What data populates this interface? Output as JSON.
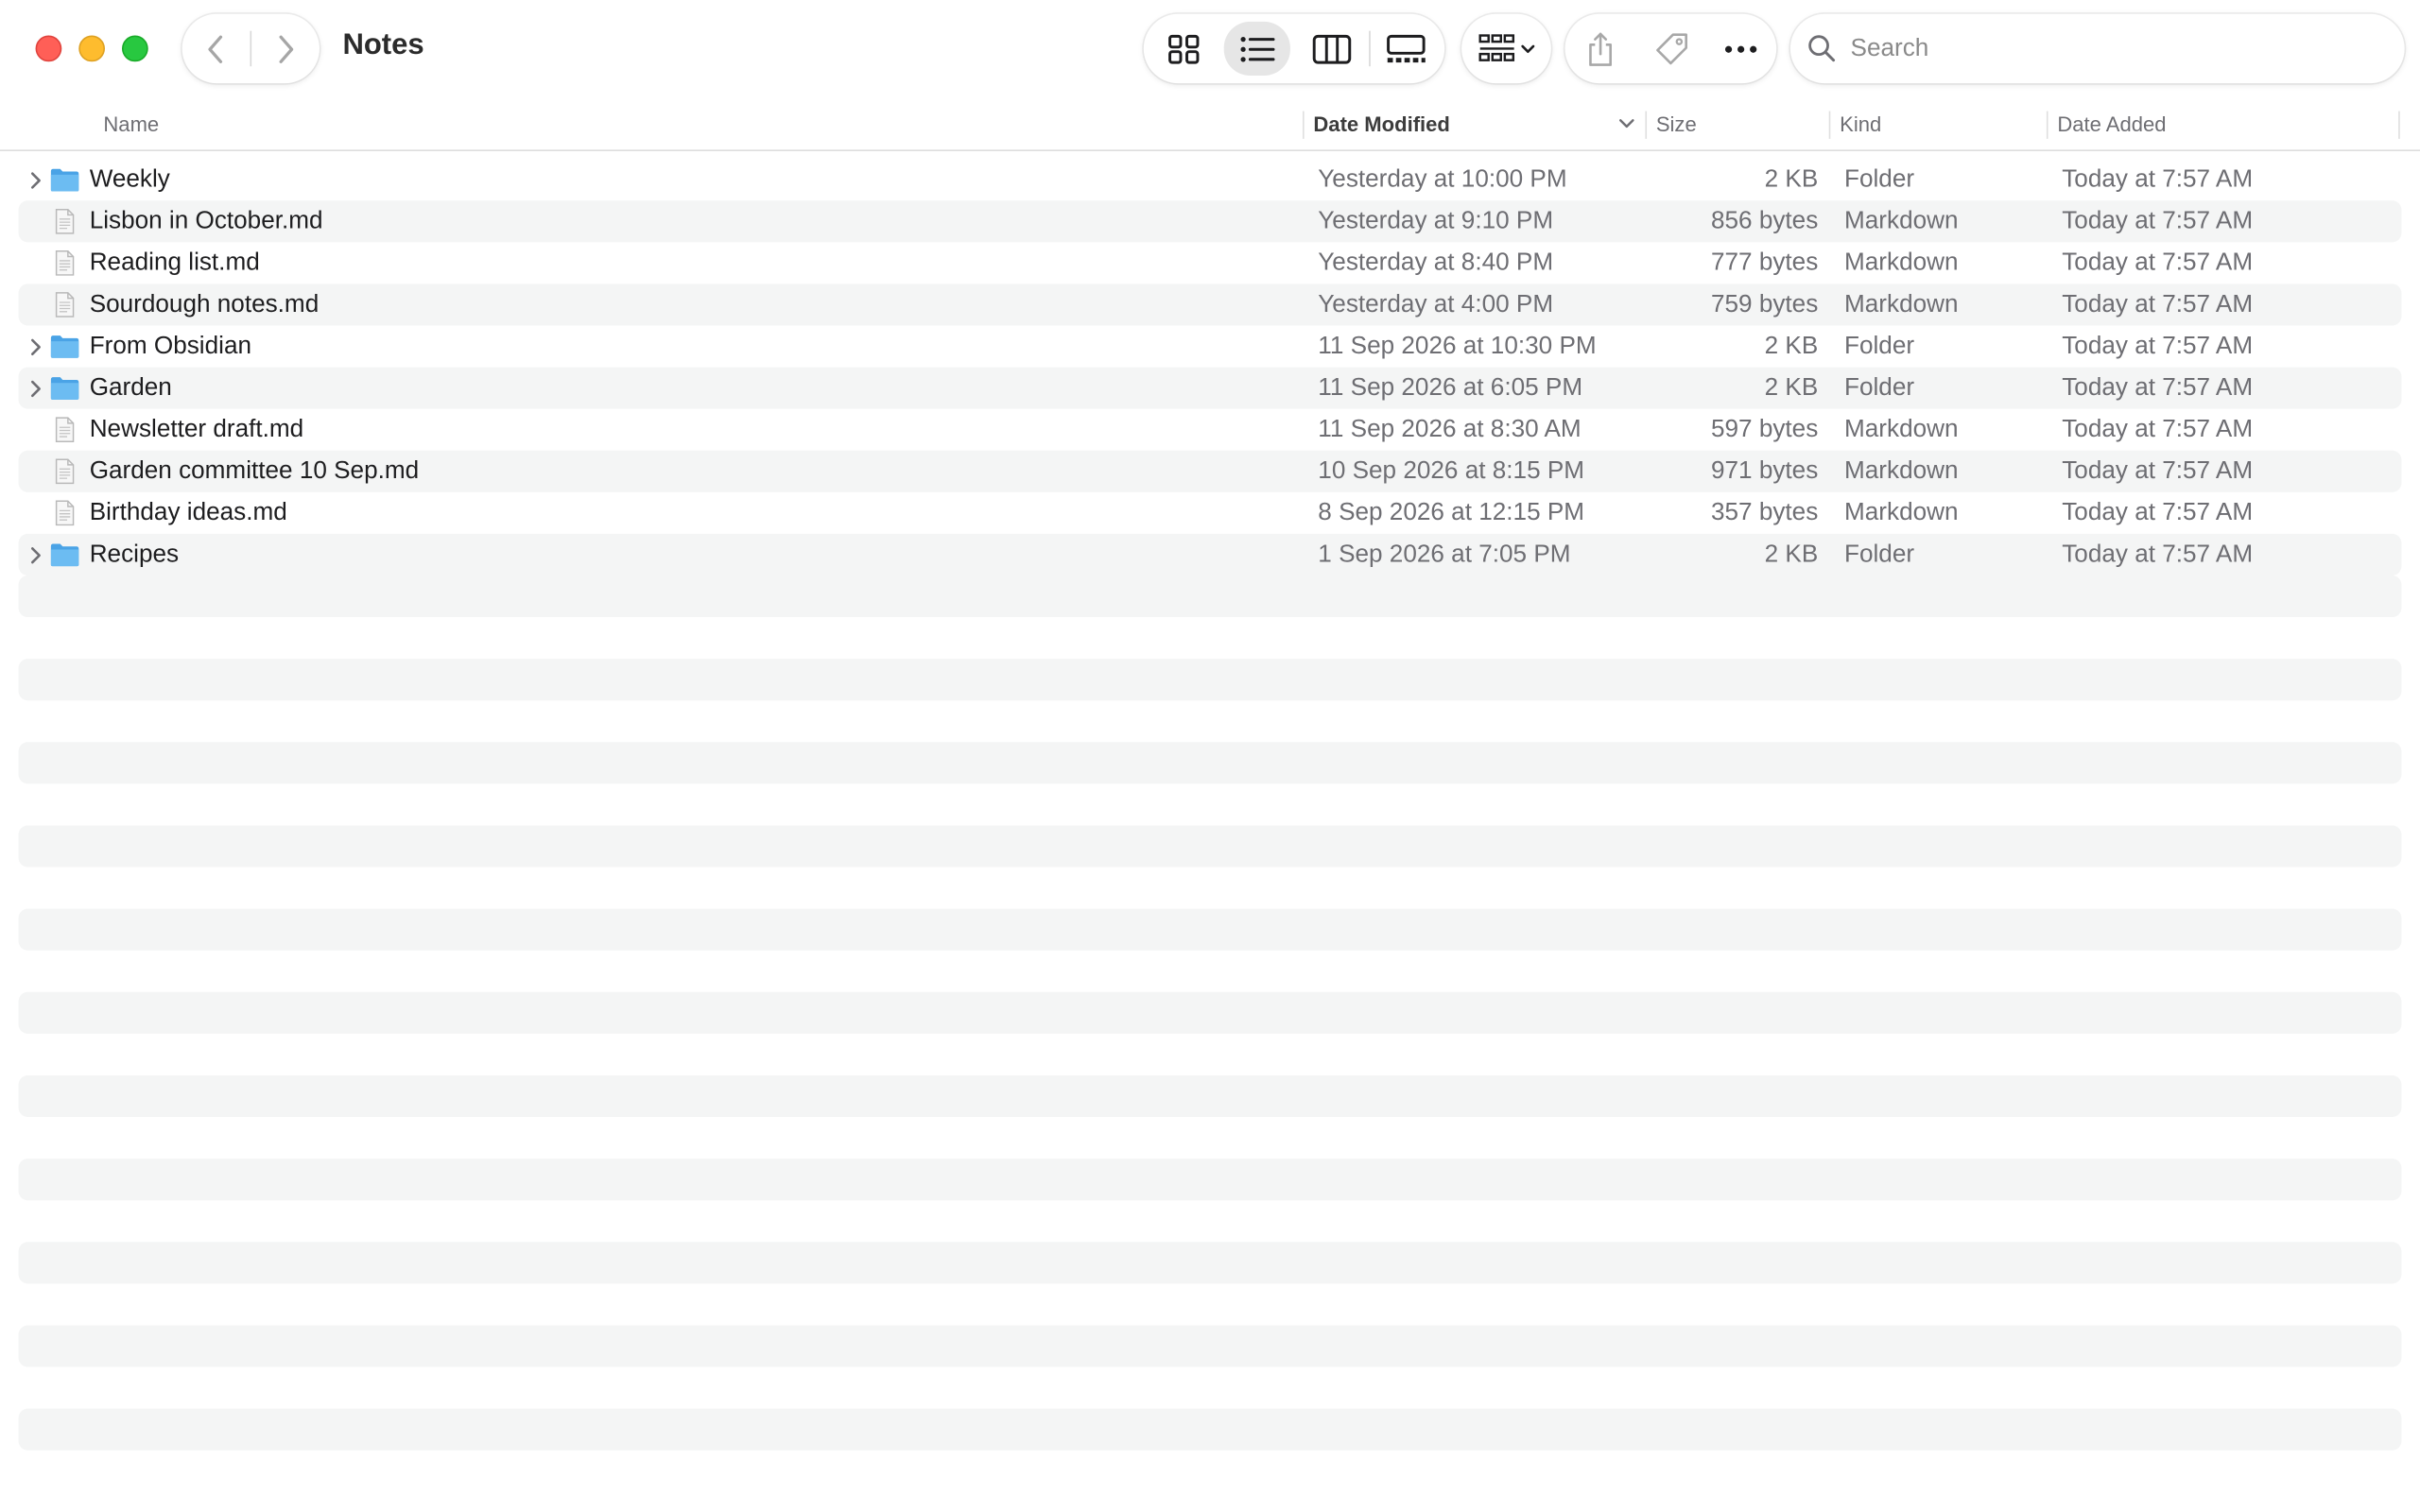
{
  "window": {
    "title": "Notes"
  },
  "toolbar": {
    "view_modes": [
      {
        "name": "icons",
        "icon": "grid-icon",
        "active": false
      },
      {
        "name": "list",
        "icon": "list-icon",
        "active": true
      },
      {
        "name": "columns",
        "icon": "columns-icon",
        "active": false
      },
      {
        "name": "gallery",
        "icon": "gallery-icon",
        "active": false
      }
    ],
    "group_icon": "group-icon",
    "actions": [
      "share-icon",
      "tag-icon",
      "more-icon"
    ],
    "search_placeholder": "Search"
  },
  "columns": {
    "name": "Name",
    "date_modified": "Date Modified",
    "size": "Size",
    "kind": "Kind",
    "date_added": "Date Added",
    "sorted_by": "Date Modified",
    "sort_direction": "descending"
  },
  "rows": [
    {
      "name": "Weekly",
      "type": "folder",
      "date_modified": "Yesterday at 10:00 PM",
      "size": "2 KB",
      "kind": "Folder",
      "date_added": "Today at 7:57 AM"
    },
    {
      "name": "Lisbon in October.md",
      "type": "file",
      "date_modified": "Yesterday at 9:10 PM",
      "size": "856 bytes",
      "kind": "Markdown",
      "date_added": "Today at 7:57 AM"
    },
    {
      "name": "Reading list.md",
      "type": "file",
      "date_modified": "Yesterday at 8:40 PM",
      "size": "777 bytes",
      "kind": "Markdown",
      "date_added": "Today at 7:57 AM"
    },
    {
      "name": "Sourdough notes.md",
      "type": "file",
      "date_modified": "Yesterday at 4:00 PM",
      "size": "759 bytes",
      "kind": "Markdown",
      "date_added": "Today at 7:57 AM"
    },
    {
      "name": "From Obsidian",
      "type": "folder",
      "date_modified": "11 Sep 2026 at 10:30 PM",
      "size": "2 KB",
      "kind": "Folder",
      "date_added": "Today at 7:57 AM"
    },
    {
      "name": "Garden",
      "type": "folder",
      "date_modified": "11 Sep 2026 at 6:05 PM",
      "size": "2 KB",
      "kind": "Folder",
      "date_added": "Today at 7:57 AM"
    },
    {
      "name": "Newsletter draft.md",
      "type": "file",
      "date_modified": "11 Sep 2026 at 8:30 AM",
      "size": "597 bytes",
      "kind": "Markdown",
      "date_added": "Today at 7:57 AM"
    },
    {
      "name": "Garden committee 10 Sep.md",
      "type": "file",
      "date_modified": "10 Sep 2026 at 8:15 PM",
      "size": "971 bytes",
      "kind": "Markdown",
      "date_added": "Today at 7:57 AM"
    },
    {
      "name": "Birthday ideas.md",
      "type": "file",
      "date_modified": "8 Sep 2026 at 12:15 PM",
      "size": "357 bytes",
      "kind": "Markdown",
      "date_added": "Today at 7:57 AM"
    },
    {
      "name": "Recipes",
      "type": "folder",
      "date_modified": "1 Sep 2026 at 7:05 PM",
      "size": "2 KB",
      "kind": "Folder",
      "date_added": "Today at 7:57 AM"
    }
  ],
  "colors": {
    "folder": "#5ab0ec",
    "stripe": "#f4f5f5",
    "close": "#ff5f57",
    "minimize": "#febc2e",
    "zoom": "#28c840"
  }
}
